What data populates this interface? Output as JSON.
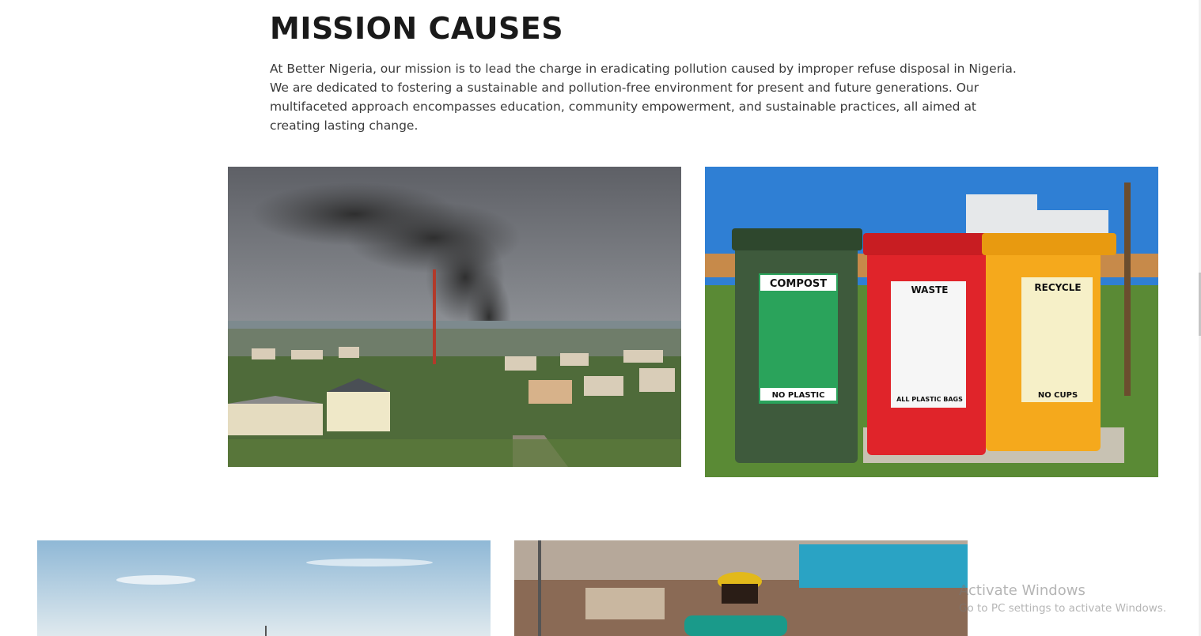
{
  "section": {
    "title": "MISSION CAUSES",
    "description": "At Better Nigeria, our mission is to lead the charge in eradicating pollution caused by improper refuse disposal in Nigeria. We are dedicated to fostering a sustainable and pollution-free environment for present and future generations. Our multifaceted approach encompasses education, community empowerment, and sustainable practices, all aimed at creating lasting change."
  },
  "images": {
    "bins": {
      "compost": {
        "label": "COMPOST",
        "sub": "NO PLASTIC",
        "color": "#2f4a35"
      },
      "waste": {
        "label": "WASTE",
        "sub": "ALL PLASTIC BAGS",
        "color": "#e0242a"
      },
      "recycle": {
        "label": "RECYCLE",
        "sub": "NO CUPS",
        "color": "#f5a91c"
      }
    }
  },
  "watermark": {
    "line1": "Activate Windows",
    "line2": "Go to PC settings to activate Windows."
  }
}
